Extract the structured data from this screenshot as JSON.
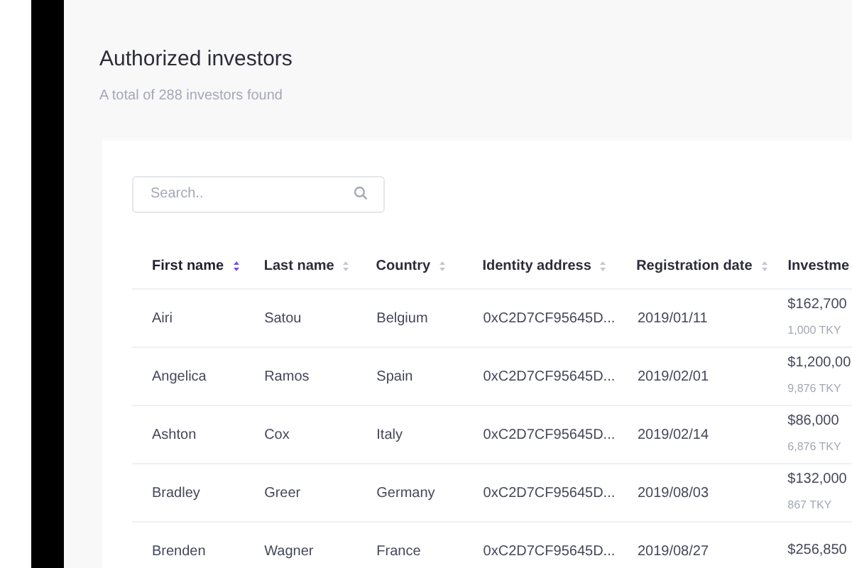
{
  "title": "Authorized investors",
  "subtitle": "A total of 288 investors found",
  "search": {
    "placeholder": "Search.."
  },
  "table": {
    "columns": [
      {
        "label": "First name",
        "sorted": true
      },
      {
        "label": "Last name",
        "sorted": false
      },
      {
        "label": "Country",
        "sorted": false
      },
      {
        "label": "Identity address",
        "sorted": false
      },
      {
        "label": "Registration date",
        "sorted": false
      },
      {
        "label": "Investme"
      }
    ],
    "rows": [
      {
        "cells": [
          "Airi",
          "Satou",
          "Belgium",
          "0xC2D7CF95645D...",
          "2019/01/11"
        ],
        "amount": "$162,700",
        "tokens": "1,000 TKY"
      },
      {
        "cells": [
          "Angelica",
          "Ramos",
          "Spain",
          "0xC2D7CF95645D...",
          "2019/02/01"
        ],
        "amount": "$1,200,00",
        "tokens": "9,876 TKY"
      },
      {
        "cells": [
          "Ashton",
          "Cox",
          "Italy",
          "0xC2D7CF95645D...",
          "2019/02/14"
        ],
        "amount": "$86,000",
        "tokens": "6,876 TKY"
      },
      {
        "cells": [
          "Bradley",
          "Greer",
          "Germany",
          "0xC2D7CF95645D...",
          "2019/08/03"
        ],
        "amount": "$132,000",
        "tokens": "867 TKY"
      },
      {
        "cells": [
          "Brenden",
          "Wagner",
          "France",
          "0xC2D7CF95645D...",
          "2019/08/27"
        ],
        "amount": "$256,850"
      }
    ]
  }
}
